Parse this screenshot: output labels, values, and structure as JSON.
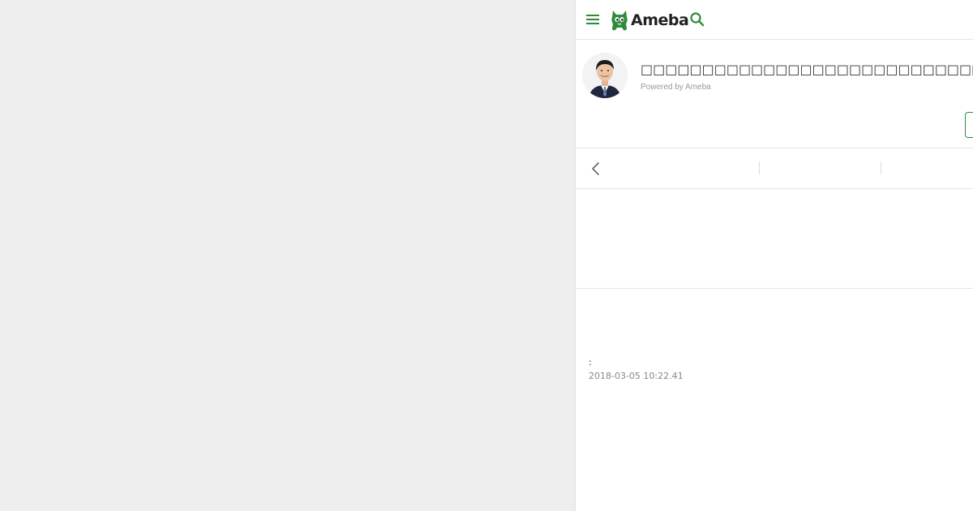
{
  "colors": {
    "background": "#eeeeee",
    "panel": "#ffffff",
    "brand_green": "#2d8c3c",
    "divider": "#e4e4e4"
  },
  "header": {
    "menu_icon": "hamburger-menu-icon",
    "logo_text": "Ameba",
    "search_icon": "search-icon"
  },
  "profile": {
    "blog_title": "□□□□□□□□□□□□□□□□□□□□□□□□□□□□□□□□□□",
    "powered_by": "Powered by Ameba"
  },
  "pager": {
    "prev_icon": "chevron-left-icon"
  },
  "entry": {
    "colon": ":",
    "datetime": "2018-03-05 10:22.41"
  }
}
